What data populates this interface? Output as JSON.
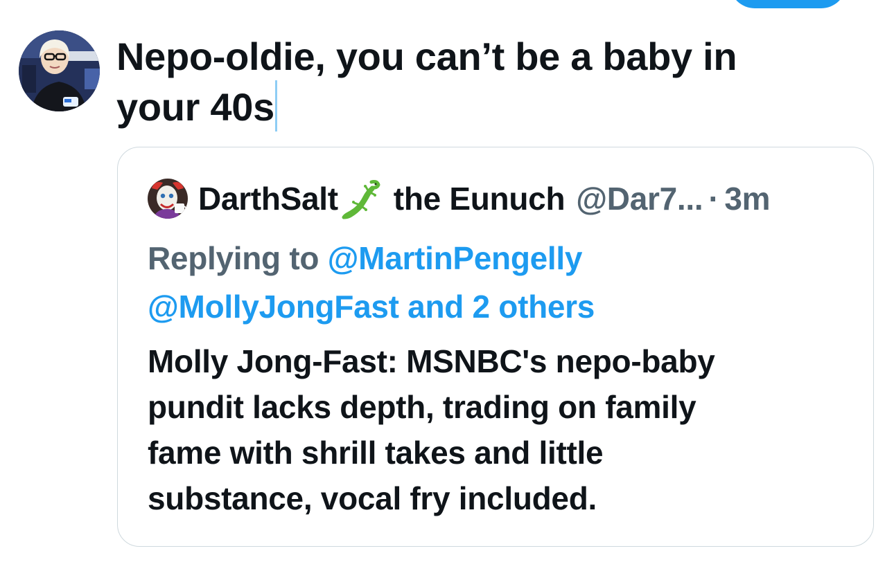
{
  "compose": {
    "text_line1": "Nepo-oldie, you can’t be a baby in",
    "text_line2": "your 40s"
  },
  "quoted_tweet": {
    "display_name": "DarthSalt",
    "name_emoji": "lizard-icon",
    "name_suffix": "the Eunuch",
    "handle": "@Dar7...",
    "separator": "·",
    "time": "3m",
    "replying_prefix": "Replying to",
    "mention_1": "@MartinPengelly",
    "mention_2_and_others": "@MollyJongFast and 2 others",
    "body_line1": "Molly Jong-Fast: MSNBC's nepo-baby",
    "body_line2": "pundit lacks depth, trading on family",
    "body_line3": "fame with shrill takes and little",
    "body_line4": "substance, vocal fry included."
  },
  "colors": {
    "accent": "#1d9bf0",
    "secondary_text": "#536471",
    "primary_text": "#0f1419",
    "card_border": "#cfd9de"
  }
}
